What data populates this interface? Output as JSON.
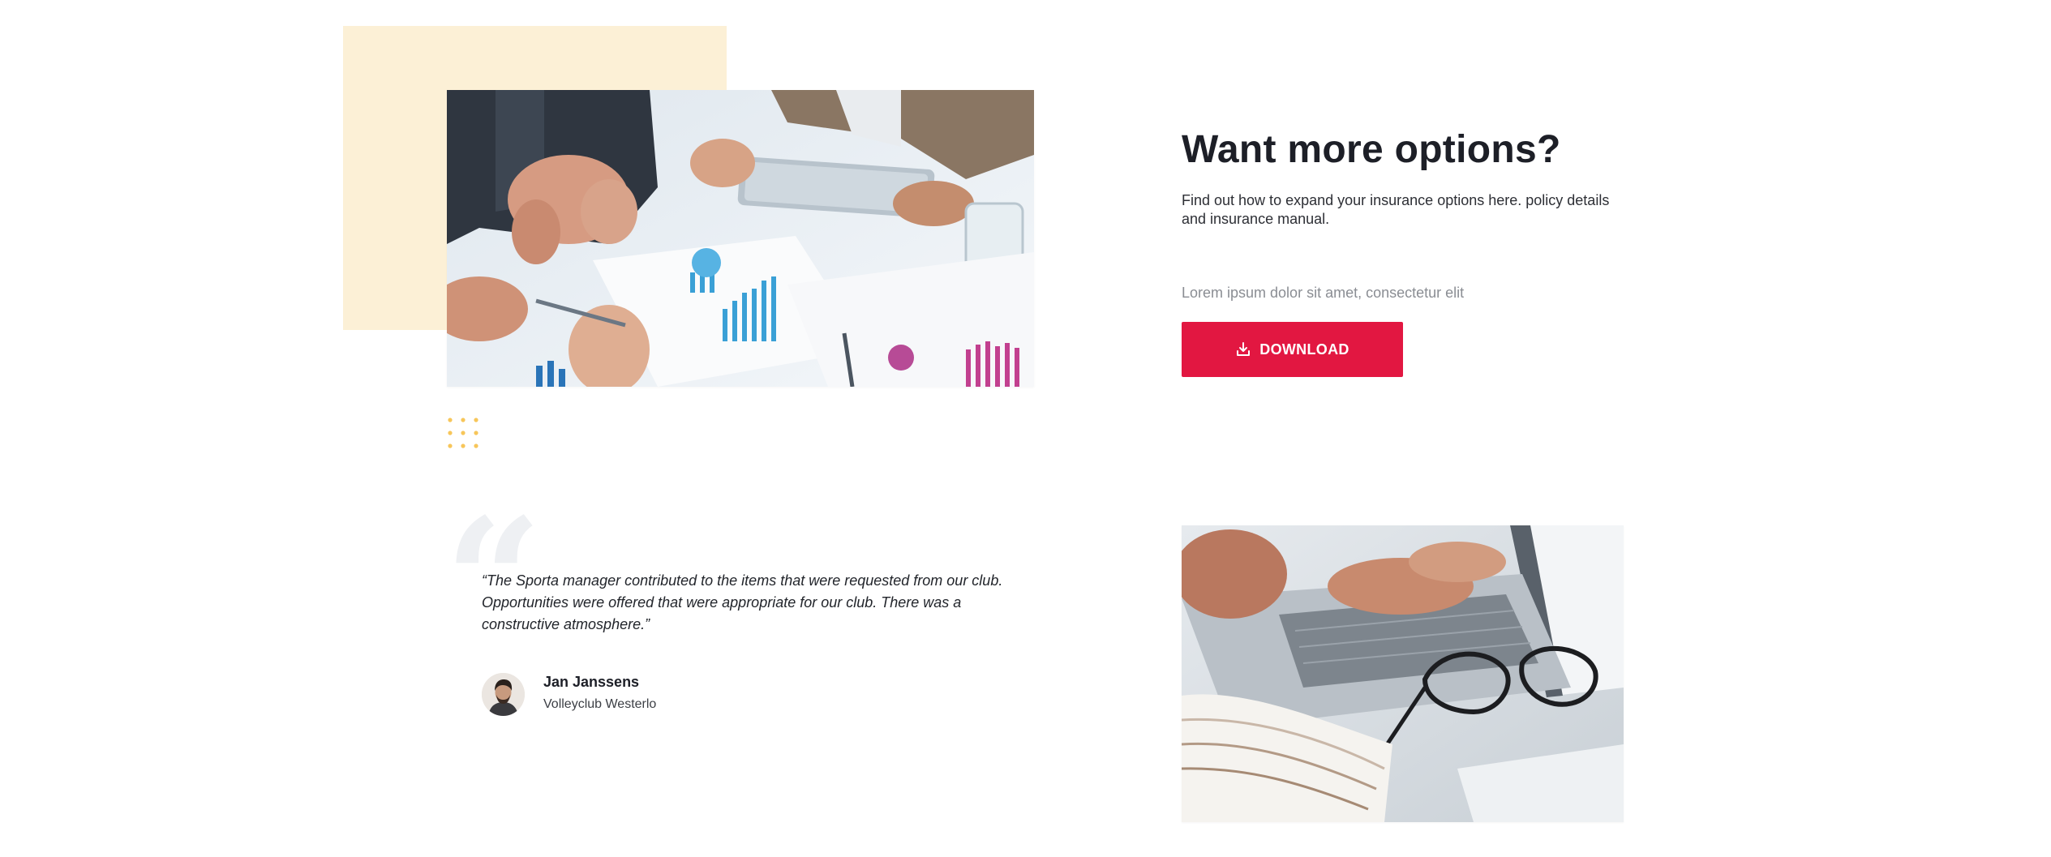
{
  "cta": {
    "heading": "Want more options?",
    "description": "Find out how to expand your insurance options here. policy details and insurance manual.",
    "caption": "Lorem ipsum dolor sit amet, consectetur elit",
    "download_label": "DOWNLOAD",
    "download_icon": "download-icon"
  },
  "testimonial": {
    "quote_glyph": "“",
    "quote": "“The Sporta manager contributed to the items that were requested from our club. Opportunities were offered that were appropriate for our club. There was a constructive atmosphere.”",
    "author_name": "Jan Janssens",
    "author_club": "Volleyclub Westerlo"
  },
  "colors": {
    "accent": "#e21741",
    "beige": "#fcf0d6",
    "dots": "#f7c65a",
    "heading": "#1d1f27",
    "muted": "#8a8d93"
  }
}
